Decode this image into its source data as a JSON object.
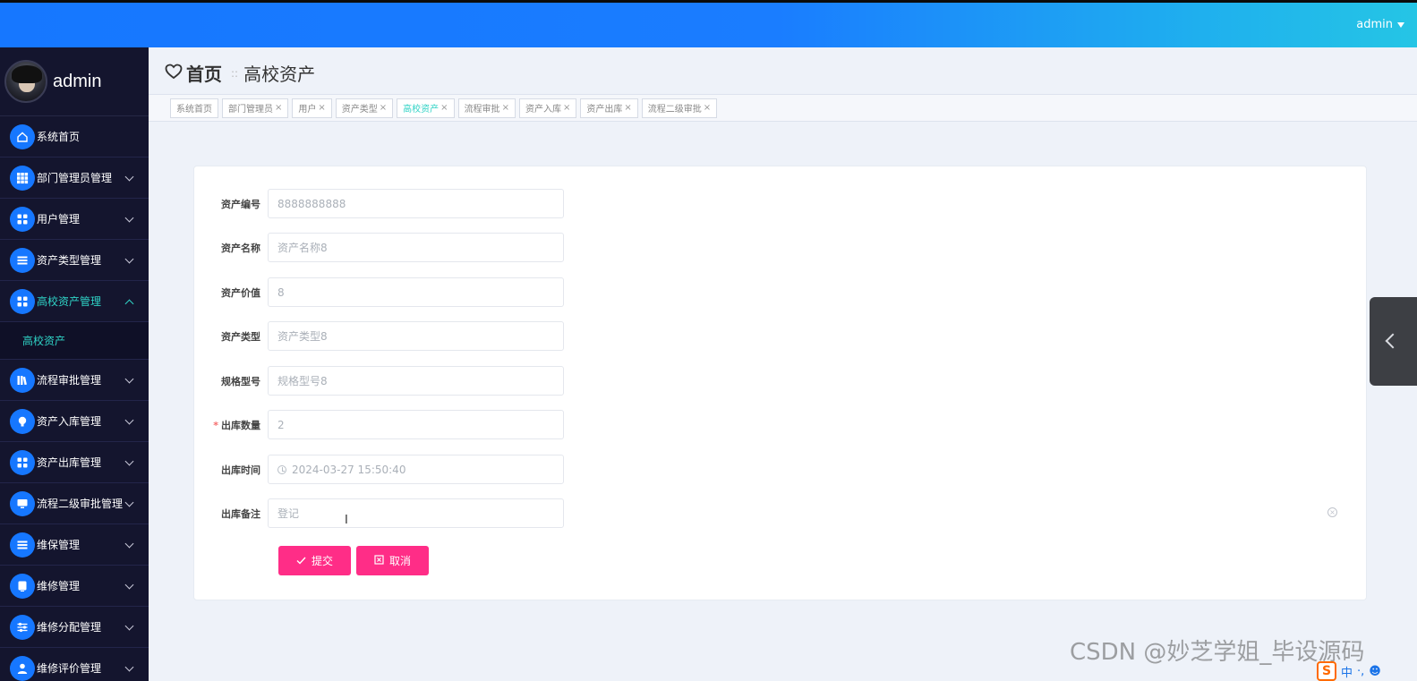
{
  "topbar": {
    "user": "admin"
  },
  "sidebar": {
    "profile_name": "admin",
    "items": [
      {
        "label": "系统首页",
        "icon": "home-icon",
        "chevron": "none"
      },
      {
        "label": "部门管理员管理",
        "icon": "grid-icon",
        "chevron": "down"
      },
      {
        "label": "用户管理",
        "icon": "apps-icon",
        "chevron": "down"
      },
      {
        "label": "资产类型管理",
        "icon": "list-icon",
        "chevron": "down"
      },
      {
        "label": "高校资产管理",
        "icon": "apps-icon",
        "chevron": "up",
        "active": true
      },
      {
        "label": "流程审批管理",
        "icon": "books-icon",
        "chevron": "down"
      },
      {
        "label": "资产入库管理",
        "icon": "bulb-icon",
        "chevron": "down"
      },
      {
        "label": "资产出库管理",
        "icon": "apps-icon",
        "chevron": "down"
      },
      {
        "label": "流程二级审批管理",
        "icon": "monitor-icon",
        "chevron": "down"
      },
      {
        "label": "维保管理",
        "icon": "list-icon",
        "chevron": "down"
      },
      {
        "label": "维修管理",
        "icon": "tablet-icon",
        "chevron": "down"
      },
      {
        "label": "维修分配管理",
        "icon": "sliders-icon",
        "chevron": "down"
      },
      {
        "label": "维修评价管理",
        "icon": "user-icon",
        "chevron": "down"
      }
    ],
    "sub_item": "高校资产"
  },
  "breadcrumb": {
    "home": "首页",
    "separator": "::",
    "current": "高校资产"
  },
  "tabs": [
    {
      "label": "系统首页",
      "closable": false
    },
    {
      "label": "部门管理员",
      "closable": true
    },
    {
      "label": "用户",
      "closable": true
    },
    {
      "label": "资产类型",
      "closable": true
    },
    {
      "label": "高校资产",
      "closable": true,
      "active": true
    },
    {
      "label": "流程审批",
      "closable": true
    },
    {
      "label": "资产入库",
      "closable": true
    },
    {
      "label": "资产出库",
      "closable": true
    },
    {
      "label": "流程二级审批",
      "closable": true
    }
  ],
  "form": {
    "fields": [
      {
        "label": "资产编号",
        "value": "8888888888",
        "required": false
      },
      {
        "label": "资产名称",
        "value": "资产名称8",
        "required": false
      },
      {
        "label": "资产价值",
        "value": "8",
        "required": false
      },
      {
        "label": "资产类型",
        "value": "资产类型8",
        "required": false
      },
      {
        "label": "规格型号",
        "value": "规格型号8",
        "required": false
      },
      {
        "label": "出库数量",
        "value": "2",
        "required": true
      },
      {
        "label": "出库时间",
        "value": "2024-03-27 15:50:40",
        "required": false,
        "has_clock": true
      },
      {
        "label": "出库备注",
        "placeholder": "登记",
        "required": false
      }
    ],
    "submit_label": "提交",
    "cancel_label": "取消",
    "required_mark": "*"
  },
  "watermark": "CSDN @妙芝学姐_毕设源码",
  "ime": {
    "logo": "S",
    "lang": "中",
    "extra": "·,",
    "extra2": "☻"
  },
  "colors": {
    "primary": "#1677ff",
    "accent": "#ff2d87",
    "active_text": "#2fd3c6",
    "sidebar_bg": "#14152e"
  }
}
